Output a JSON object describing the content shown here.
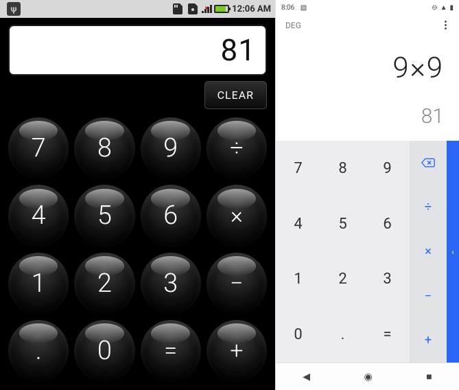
{
  "left": {
    "status": {
      "time": "12:06 AM"
    },
    "display": "81",
    "clear_label": "CLEAR",
    "keys": [
      {
        "label": "7",
        "name": "key-7"
      },
      {
        "label": "8",
        "name": "key-8"
      },
      {
        "label": "9",
        "name": "key-9"
      },
      {
        "label": "÷",
        "name": "key-divide",
        "op": true
      },
      {
        "label": "4",
        "name": "key-4"
      },
      {
        "label": "5",
        "name": "key-5"
      },
      {
        "label": "6",
        "name": "key-6"
      },
      {
        "label": "×",
        "name": "key-multiply",
        "op": true
      },
      {
        "label": "1",
        "name": "key-1"
      },
      {
        "label": "2",
        "name": "key-2"
      },
      {
        "label": "3",
        "name": "key-3"
      },
      {
        "label": "−",
        "name": "key-minus",
        "op": true
      },
      {
        "label": ".",
        "name": "key-dot"
      },
      {
        "label": "0",
        "name": "key-0"
      },
      {
        "label": "=",
        "name": "key-equals",
        "op": true
      },
      {
        "label": "+",
        "name": "key-plus",
        "op": true
      }
    ]
  },
  "right": {
    "status": {
      "time": "8:06"
    },
    "mode": "DEG",
    "expression": "9×9",
    "result": "81",
    "nums": [
      {
        "label": "7",
        "name": "num-7"
      },
      {
        "label": "8",
        "name": "num-8"
      },
      {
        "label": "9",
        "name": "num-9"
      },
      {
        "label": "4",
        "name": "num-4"
      },
      {
        "label": "5",
        "name": "num-5"
      },
      {
        "label": "6",
        "name": "num-6"
      },
      {
        "label": "1",
        "name": "num-1"
      },
      {
        "label": "2",
        "name": "num-2"
      },
      {
        "label": "3",
        "name": "num-3"
      },
      {
        "label": "0",
        "name": "num-0"
      },
      {
        "label": ".",
        "name": "num-dot"
      },
      {
        "label": "=",
        "name": "num-equals"
      }
    ],
    "ops": [
      {
        "name": "op-backspace",
        "icon": "bksp"
      },
      {
        "name": "op-divide",
        "label": "÷"
      },
      {
        "name": "op-multiply",
        "label": "×"
      },
      {
        "name": "op-minus",
        "label": "−"
      },
      {
        "name": "op-plus",
        "label": "+"
      }
    ]
  }
}
